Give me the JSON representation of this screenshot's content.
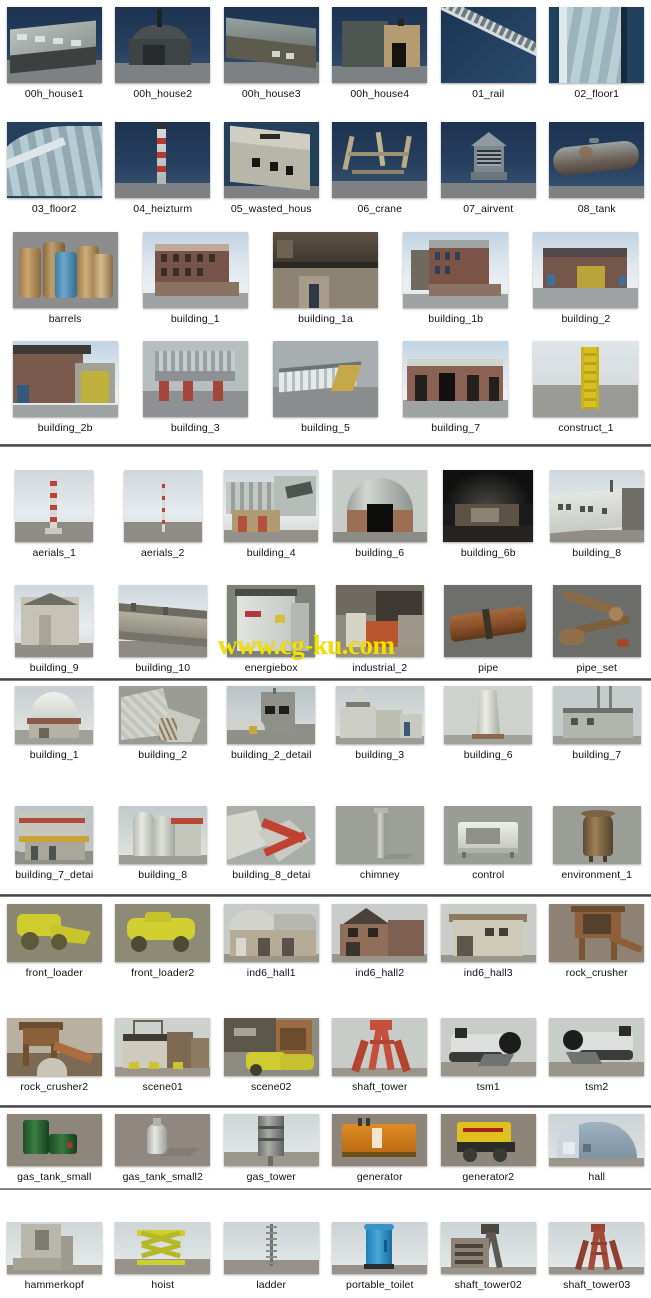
{
  "watermark": "www.cg-ku.com",
  "sections": [
    {
      "id": "section-1",
      "columns": 6,
      "rows": [
        {
          "items": [
            {
              "label": "00h_house1",
              "art": "house-long-metal"
            },
            {
              "label": "00h_house2",
              "art": "barrel-roof-hall"
            },
            {
              "label": "00h_house3",
              "art": "long-shed"
            },
            {
              "label": "00h_house4",
              "art": "tan-barn"
            },
            {
              "label": "01_rail",
              "art": "rail-track"
            },
            {
              "label": "02_floor1",
              "art": "tiled-floor"
            }
          ]
        },
        {
          "items": [
            {
              "label": "03_floor2",
              "art": "curved-floor"
            },
            {
              "label": "04_heizturm",
              "art": "striped-tower"
            },
            {
              "label": "05_wasted_hous",
              "art": "ruined-house"
            },
            {
              "label": "06_crane",
              "art": "crane-frame"
            },
            {
              "label": "07_airvent",
              "art": "air-vent"
            },
            {
              "label": "08_tank",
              "art": "rust-tank"
            }
          ]
        }
      ]
    },
    {
      "id": "section-2",
      "columns": 5,
      "rows": [
        {
          "items": [
            {
              "label": "barrels",
              "art": "barrels"
            },
            {
              "label": "building_1",
              "art": "brick-factory"
            },
            {
              "label": "building_1a",
              "art": "industrial-facade"
            },
            {
              "label": "building_1b",
              "art": "brick-factory-2"
            },
            {
              "label": "building_2",
              "art": "brick-hall-yellow"
            }
          ]
        },
        {
          "items": [
            {
              "label": "building_2b",
              "art": "brick-hall-yellow-2"
            },
            {
              "label": "building_3",
              "art": "steel-platform"
            },
            {
              "label": "building_5",
              "art": "long-white-shed"
            },
            {
              "label": "building_7",
              "art": "brick-garage"
            },
            {
              "label": "construct_1",
              "art": "yellow-lattice-tower"
            }
          ]
        }
      ]
    },
    {
      "id": "section-3",
      "columns": 6,
      "rows": [
        {
          "items": [
            {
              "label": "aerials_1",
              "art": "red-white-mast"
            },
            {
              "label": "aerials_2",
              "art": "thin-mast"
            },
            {
              "label": "building_4",
              "art": "plant-complex"
            },
            {
              "label": "building_6",
              "art": "arched-hangar"
            },
            {
              "label": "building_6b",
              "art": "dark-interior"
            },
            {
              "label": "building_8",
              "art": "white-long-hall"
            }
          ]
        },
        {
          "items": [
            {
              "label": "building_9",
              "art": "small-white-shed"
            },
            {
              "label": "building_10",
              "art": "long-low-barrack"
            },
            {
              "label": "energiebox",
              "art": "power-cabinet"
            },
            {
              "label": "industrial_2",
              "art": "industrial-yard"
            },
            {
              "label": "pipe",
              "art": "pipe-bundle"
            },
            {
              "label": "pipe_set",
              "art": "pipe-set"
            }
          ]
        }
      ]
    },
    {
      "id": "section-4",
      "columns": 6,
      "rows": [
        {
          "items": [
            {
              "label": "building_1",
              "art": "dome-building"
            },
            {
              "label": "building_2",
              "art": "angular-concrete"
            },
            {
              "label": "building_2_detail",
              "art": "concrete-detail"
            },
            {
              "label": "building_3",
              "art": "refinery-block"
            },
            {
              "label": "building_6",
              "art": "cooling-tower"
            },
            {
              "label": "building_7",
              "art": "plant-with-stacks"
            }
          ]
        },
        {
          "items": [
            {
              "label": "building_7_detai",
              "art": "plant-detail"
            },
            {
              "label": "building_8",
              "art": "silo-pair"
            },
            {
              "label": "building_8_detai",
              "art": "silo-detail"
            },
            {
              "label": "chimney",
              "art": "chimney"
            },
            {
              "label": "control",
              "art": "control-box"
            },
            {
              "label": "environment_1",
              "art": "rust-cylinder"
            }
          ]
        }
      ]
    },
    {
      "id": "section-5",
      "columns": 6,
      "rows": [
        {
          "items": [
            {
              "label": "front_loader",
              "art": "yellow-loader"
            },
            {
              "label": "front_loader2",
              "art": "yellow-loader-2"
            },
            {
              "label": "ind6_hall1",
              "art": "arched-brick-hall"
            },
            {
              "label": "ind6_hall2",
              "art": "gable-brick-hall"
            },
            {
              "label": "ind6_hall3",
              "art": "stone-hall"
            },
            {
              "label": "rock_crusher",
              "art": "rock-crusher"
            }
          ]
        },
        {
          "items": [
            {
              "label": "rock_crusher2",
              "art": "rock-crusher-2"
            },
            {
              "label": "scene01",
              "art": "mine-scene"
            },
            {
              "label": "scene02",
              "art": "mine-scene-2"
            },
            {
              "label": "shaft_tower",
              "art": "red-shaft-tower"
            },
            {
              "label": "tsm1",
              "art": "mining-machine"
            },
            {
              "label": "tsm2",
              "art": "mining-machine-2"
            }
          ]
        }
      ]
    },
    {
      "id": "section-6",
      "columns": 6,
      "rows": [
        {
          "items": [
            {
              "label": "gas_tank_small",
              "art": "green-jerrycan"
            },
            {
              "label": "gas_tank_small2",
              "art": "gas-bottle"
            },
            {
              "label": "gas_tower",
              "art": "gas-tower"
            },
            {
              "label": "generator",
              "art": "orange-container"
            },
            {
              "label": "generator2",
              "art": "yellow-generator"
            },
            {
              "label": "hall",
              "art": "blue-nissen-hut"
            }
          ]
        }
      ]
    },
    {
      "id": "section-7",
      "columns": 6,
      "rows": [
        {
          "items": [
            {
              "label": "hammerkopf",
              "art": "headframe-concrete"
            },
            {
              "label": "hoist",
              "art": "scissor-lift"
            },
            {
              "label": "ladder",
              "art": "ladder-mast"
            },
            {
              "label": "portable_toilet",
              "art": "portable-toilet"
            },
            {
              "label": "shaft_tower02",
              "art": "shaft-tower-02"
            },
            {
              "label": "shaft_tower03",
              "art": "shaft-tower-03"
            }
          ]
        }
      ]
    }
  ]
}
